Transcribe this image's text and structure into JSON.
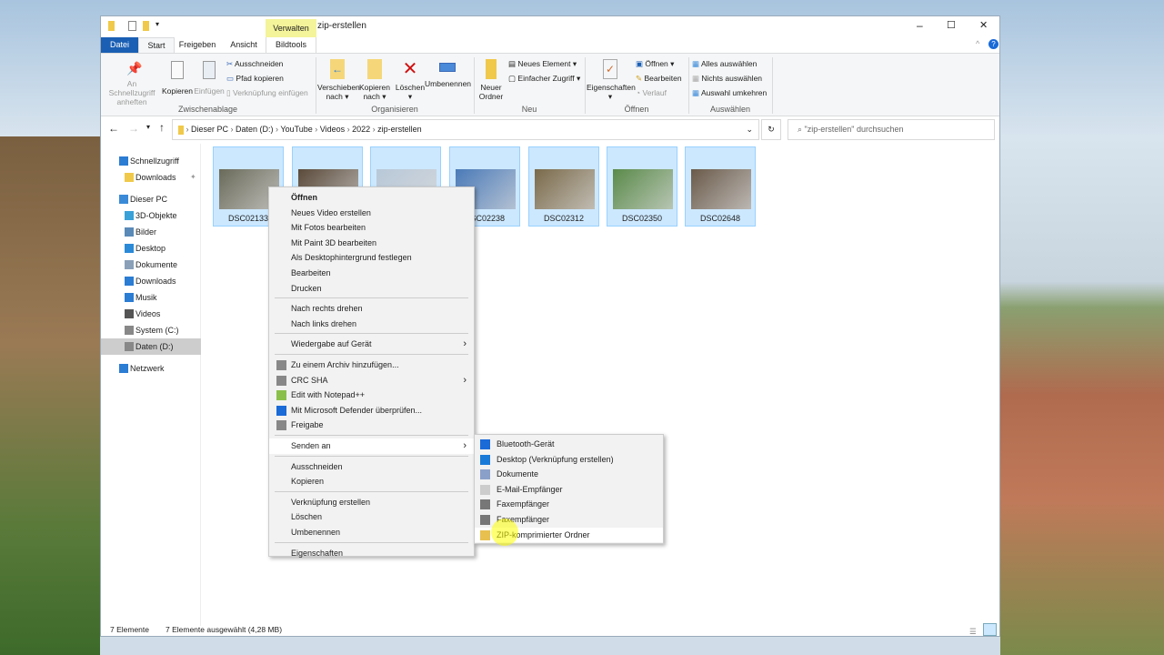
{
  "window": {
    "title": "zip-erstellen",
    "contextual_tab_group": "Verwalten",
    "controls": {
      "minimize": "–",
      "maximize": "☐",
      "close": "✕"
    }
  },
  "tabs": [
    {
      "label": "Datei",
      "active": false,
      "file": true
    },
    {
      "label": "Start",
      "active": true
    },
    {
      "label": "Freigeben"
    },
    {
      "label": "Ansicht"
    },
    {
      "label": "Bildtools"
    }
  ],
  "ribbon": {
    "zwischenablage": {
      "label": "Zwischenablage",
      "pin": "An Schnellzugriff anheften",
      "copy": "Kopieren",
      "paste": "Einfügen",
      "cut": "Ausschneiden",
      "copy_path": "Pfad kopieren",
      "paste_shortcut": "Verknüpfung einfügen"
    },
    "organisieren": {
      "label": "Organisieren",
      "move": "Verschieben nach",
      "copy_to": "Kopieren nach",
      "delete": "Löschen",
      "rename": "Umbenennen"
    },
    "neu": {
      "label": "Neu",
      "new_folder": "Neuer Ordner",
      "new_item": "Neues Element",
      "easy_access": "Einfacher Zugriff"
    },
    "oeffnen": {
      "label": "Öffnen",
      "properties": "Eigenschaften",
      "open": "Öffnen",
      "edit": "Bearbeiten",
      "history": "Verlauf"
    },
    "auswaehlen": {
      "label": "Auswählen",
      "select_all": "Alles auswählen",
      "select_none": "Nichts auswählen",
      "invert": "Auswahl umkehren"
    }
  },
  "address": {
    "crumbs": [
      "Dieser PC",
      "Daten (D:)",
      "YouTube",
      "Videos",
      "2022",
      "zip-erstellen"
    ],
    "search_placeholder": "\"zip-erstellen\" durchsuchen"
  },
  "nav": [
    {
      "label": "Schnellzugriff",
      "icon": "star-icon",
      "indent": 0,
      "color": "#2b7cd3"
    },
    {
      "label": "Downloads",
      "icon": "folder-icon",
      "indent": 1,
      "color": "#f0c94a",
      "pinned": true
    },
    {
      "label": "Dieser PC",
      "icon": "computer-icon",
      "indent": 0,
      "color": "#3a8ad8"
    },
    {
      "label": "3D-Objekte",
      "icon": "cube-icon",
      "indent": 1,
      "color": "#3aa0d8"
    },
    {
      "label": "Bilder",
      "icon": "pictures-icon",
      "indent": 1,
      "color": "#5a8ab8"
    },
    {
      "label": "Desktop",
      "icon": "desktop-icon",
      "indent": 1,
      "color": "#2b8ad8"
    },
    {
      "label": "Dokumente",
      "icon": "documents-icon",
      "indent": 1,
      "color": "#8aa0b8"
    },
    {
      "label": "Downloads",
      "icon": "download-icon",
      "indent": 1,
      "color": "#2b7cd3"
    },
    {
      "label": "Musik",
      "icon": "music-icon",
      "indent": 1,
      "color": "#2b7cd3"
    },
    {
      "label": "Videos",
      "icon": "video-icon",
      "indent": 1,
      "color": "#555"
    },
    {
      "label": "System (C:)",
      "icon": "drive-icon",
      "indent": 1,
      "color": "#888"
    },
    {
      "label": "Daten (D:)",
      "icon": "drive-icon",
      "indent": 1,
      "color": "#888",
      "selected": true
    },
    {
      "label": "Netzwerk",
      "icon": "network-icon",
      "indent": 0,
      "color": "#2b7cd3"
    }
  ],
  "files": [
    {
      "name": "DSC02133",
      "color": "#6a6a5a"
    },
    {
      "name": "",
      "color": "#5a4a3a"
    },
    {
      "name": "",
      "color": "#b8c8d8"
    },
    {
      "name": "DSC02238",
      "color": "#4a7ab8"
    },
    {
      "name": "DSC02312",
      "color": "#7a6a4a"
    },
    {
      "name": "DSC02350",
      "color": "#5a8a4a"
    },
    {
      "name": "DSC02648",
      "color": "#6a5a4a"
    }
  ],
  "status": {
    "count": "7 Elemente",
    "selected": "7 Elemente ausgewählt (4,28 MB)"
  },
  "context_menu": [
    {
      "label": "Öffnen",
      "bold": true
    },
    {
      "label": "Neues Video erstellen"
    },
    {
      "label": "Mit Fotos bearbeiten"
    },
    {
      "label": "Mit Paint 3D bearbeiten"
    },
    {
      "label": "Als Desktophintergrund festlegen"
    },
    {
      "label": "Bearbeiten"
    },
    {
      "label": "Drucken"
    },
    {
      "sep": true
    },
    {
      "label": "Nach rechts drehen"
    },
    {
      "label": "Nach links drehen"
    },
    {
      "sep": true
    },
    {
      "label": "Wiedergabe auf Gerät",
      "submenu": true
    },
    {
      "sep": true
    },
    {
      "label": "Zu einem Archiv hinzufügen...",
      "icon": "archive-icon"
    },
    {
      "label": "CRC SHA",
      "icon": "archive-icon",
      "submenu": true
    },
    {
      "label": "Edit with Notepad++",
      "icon": "notepad-icon"
    },
    {
      "label": "Mit Microsoft Defender überprüfen...",
      "icon": "defender-icon"
    },
    {
      "label": "Freigabe",
      "icon": "share-icon"
    },
    {
      "sep": true
    },
    {
      "label": "Senden an",
      "submenu": true,
      "highlighted": true
    },
    {
      "sep": true
    },
    {
      "label": "Ausschneiden"
    },
    {
      "label": "Kopieren"
    },
    {
      "sep": true
    },
    {
      "label": "Verknüpfung erstellen"
    },
    {
      "label": "Löschen"
    },
    {
      "label": "Umbenennen"
    },
    {
      "sep": true
    },
    {
      "label": "Eigenschaften"
    }
  ],
  "send_to_menu": [
    {
      "label": "Bluetooth-Gerät",
      "icon": "bluetooth-icon",
      "color": "#1a6ad8"
    },
    {
      "label": "Desktop (Verknüpfung erstellen)",
      "icon": "desktop-icon",
      "color": "#1a7ad8"
    },
    {
      "label": "Dokumente",
      "icon": "documents-icon",
      "color": "#8aa0c8"
    },
    {
      "label": "E-Mail-Empfänger",
      "icon": "mail-icon",
      "color": "#ccc"
    },
    {
      "label": "Faxempfänger",
      "icon": "fax-icon",
      "color": "#777"
    },
    {
      "label": "Faxempfänger",
      "icon": "fax-icon",
      "color": "#777"
    },
    {
      "label": "ZIP-komprimierter Ordner",
      "icon": "zip-folder-icon",
      "color": "#e8c050",
      "highlighted": true
    }
  ]
}
